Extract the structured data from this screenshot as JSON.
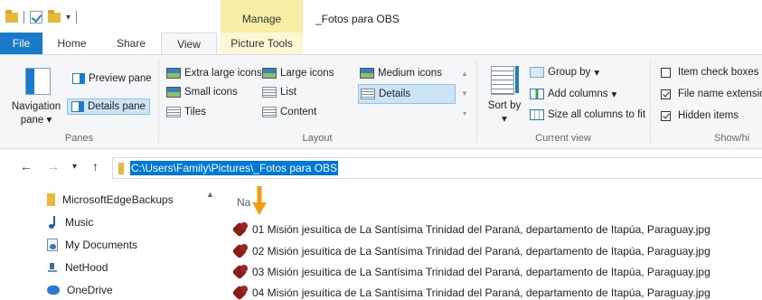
{
  "window": {
    "title": "_Fotos para OBS",
    "context_tab_group": "Manage"
  },
  "tabs": {
    "file": "File",
    "home": "Home",
    "share": "Share",
    "view": "View",
    "picture_tools": "Picture Tools"
  },
  "ribbon": {
    "panes": {
      "navigation_pane": "Navigation pane",
      "navigation_pane_arrow": "▾",
      "preview_pane": "Preview pane",
      "details_pane": "Details pane",
      "group_label": "Panes"
    },
    "layout": {
      "extra_large_icons": "Extra large icons",
      "large_icons": "Large icons",
      "medium_icons": "Medium icons",
      "small_icons": "Small icons",
      "list": "List",
      "details": "Details",
      "tiles": "Tiles",
      "content": "Content",
      "selected": "Details",
      "group_label": "Layout"
    },
    "current_view": {
      "sort_by": "Sort by",
      "group_by": "Group by",
      "add_columns": "Add columns",
      "size_all_columns": "Size all columns to fit",
      "group_label": "Current view"
    },
    "show_hide": {
      "item_check_boxes": "Item check boxes",
      "item_check_boxes_checked": false,
      "file_name_extensions": "File name extensio",
      "file_name_extensions_checked": true,
      "hidden_items": "Hidden items",
      "hidden_items_checked": true,
      "group_label": "Show/hi"
    }
  },
  "address_bar": {
    "path": "C:\\Users\\Family\\Pictures\\_Fotos para OBS"
  },
  "nav_pane": {
    "items": [
      {
        "label": "MicrosoftEdgeBackups",
        "icon": "folder-icon"
      },
      {
        "label": "Music",
        "icon": "music-icon"
      },
      {
        "label": "My Documents",
        "icon": "documents-icon"
      },
      {
        "label": "NetHood",
        "icon": "network-shortcut-icon"
      },
      {
        "label": "OneDrive",
        "icon": "onedrive-icon"
      }
    ]
  },
  "file_list": {
    "column_name": "Na",
    "files": [
      "01 Misión jesuítica de La Santísima Trinidad del Paraná, departamento de Itapúa, Paraguay.jpg",
      "02 Misión jesuítica de La Santísima Trinidad del Paraná, departamento de Itapúa, Paraguay.jpg",
      "03 Misión jesuítica de La Santísima Trinidad del Paraná, departamento de Itapúa, Paraguay.jpg",
      "04 Misión jesuítica de La Santísima Trinidad del Paraná, departamento de Itapúa, Paraguay.jpg"
    ]
  },
  "colors": {
    "file_tab": "#1979ca",
    "manage_tab": "#f7efa6",
    "selection": "#0078d7",
    "annotation_arrow": "#f39c12"
  }
}
